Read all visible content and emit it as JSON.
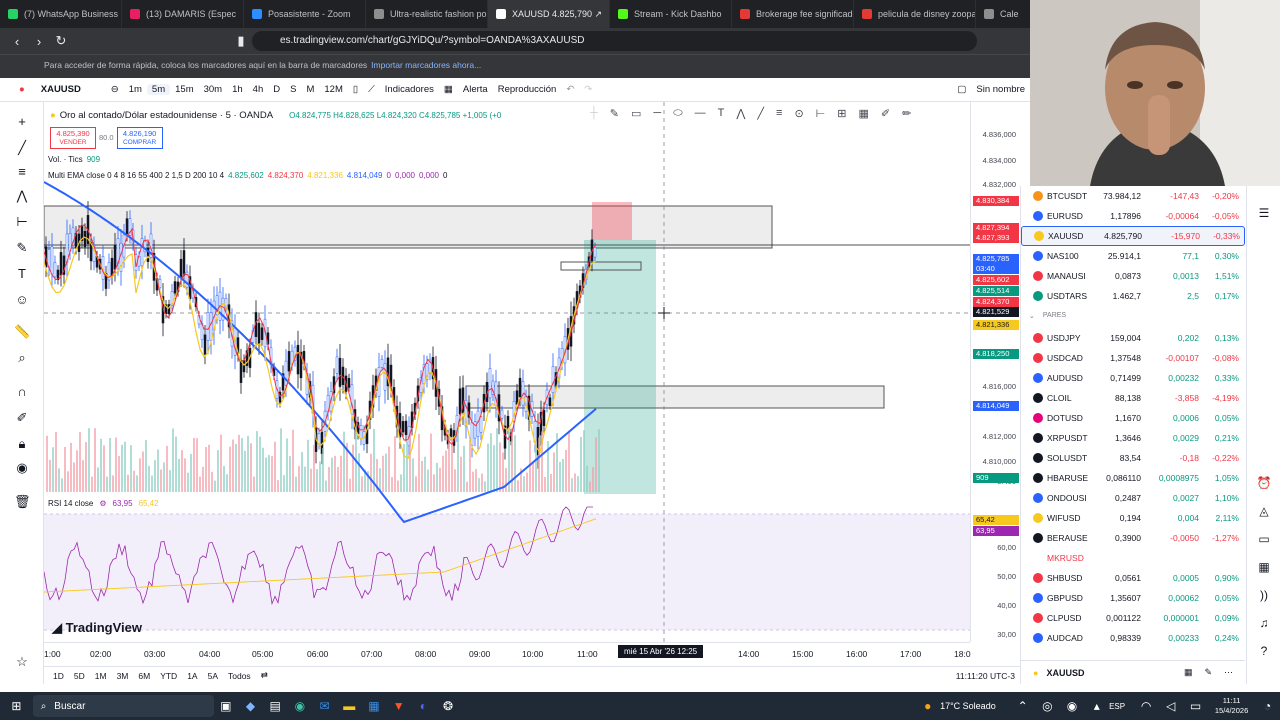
{
  "browser": {
    "tabs": [
      {
        "label": "(7) WhatsApp Business",
        "color": "#25d366"
      },
      {
        "label": "(13) DAMARIS (Espec",
        "color": "#e91e63"
      },
      {
        "label": "Posasistente - Zoom",
        "color": "#2d8cff"
      },
      {
        "label": "Ultra-realistic fashion po",
        "color": "#8e8e8e"
      },
      {
        "label": "XAUUSD 4.825,790 ↗",
        "color": "#ffffff"
      },
      {
        "label": "Stream - Kick Dashbo",
        "color": "#53fc18"
      },
      {
        "label": "Brokerage fee significado",
        "color": "#e53935"
      },
      {
        "label": "pelicula de disney zoopa",
        "color": "#e53935"
      },
      {
        "label": "Cale",
        "color": "#8e8e8e"
      }
    ],
    "url": "es.tradingview.com/chart/gGJYiDQu/?symbol=OANDA%3AXAUUSD",
    "bookmarks_text": "Para acceder de forma rápida, coloca los marcadores aquí en la barra de marcadores",
    "bookmarks_link": "Importar marcadores ahora..."
  },
  "toolbar": {
    "symbol": "XAUUSD",
    "intervals": [
      "1m",
      "5m",
      "15m",
      "30m",
      "1h",
      "4h",
      "D",
      "S",
      "M",
      "12M"
    ],
    "indicators": "Indicadores",
    "alert": "Alerta",
    "replay": "Reproducción",
    "sin_nombre": "Sin nombre",
    "guardar": "Guardar"
  },
  "legend": {
    "title": "Oro al contado/Dólar estadounidense · 5 · OANDA",
    "ohlc": "O4.824,775 H4.828,625 L4.824,320 C4.825,785 +1,005 (+0",
    "sell_price": "4.825,390",
    "sell_label": "VENDER",
    "spread": "80.0",
    "buy_price": "4.826,190",
    "buy_label": "COMPRAR",
    "vol": "Vol. · Tics",
    "vol_value": "909",
    "ema": "Multi EMA close 0 4 8 16 55 400 2 1,5 D 200 10 4",
    "ema_values": [
      "4.825,602",
      "4.824,370",
      "4.821,336",
      "4.814,049",
      "0",
      "0,000",
      "0,000",
      "0"
    ],
    "rsi": "RSI 14 close",
    "rsi_values": [
      "63,95",
      "65,42"
    ]
  },
  "price_axis": {
    "ticks": [
      "4.836,000",
      "4.834,000",
      "4.832,000",
      "4.816,000",
      "4.812,000",
      "4.810,000",
      "8.400",
      "70,00",
      "60,00",
      "50,00",
      "40,00",
      "30,00"
    ],
    "labels": [
      {
        "text": "4.830,384",
        "color": "#f23645"
      },
      {
        "text": "4.827,394",
        "color": "#f23645"
      },
      {
        "text": "4.827,393",
        "color": "#f23645"
      },
      {
        "text": "4.825,785",
        "color": "#2962ff"
      },
      {
        "text": "03:40",
        "color": "#2962ff"
      },
      {
        "text": "4.825,602",
        "color": "#f23645"
      },
      {
        "text": "4.825,514",
        "color": "#089981"
      },
      {
        "text": "4.824,370",
        "color": "#f23645"
      },
      {
        "text": "4.821,529",
        "color": "#131722"
      },
      {
        "text": "4.821,336",
        "color": "#f7c81e"
      },
      {
        "text": "4.818,250",
        "color": "#089981"
      },
      {
        "text": "4.814,049",
        "color": "#2962ff"
      },
      {
        "text": "909",
        "color": "#089981"
      },
      {
        "text": "65,42",
        "color": "#f7c81e"
      },
      {
        "text": "63,95",
        "color": "#9c27b0"
      }
    ]
  },
  "time_axis": {
    "ticks": [
      "1:00",
      "02:00",
      "03:00",
      "04:00",
      "05:00",
      "06:00",
      "07:00",
      "08:00",
      "09:00",
      "10:00",
      "11:00",
      "14:00",
      "15:00",
      "16:00",
      "17:00",
      "18:0"
    ],
    "crosshair": "mié 15 Abr '26   12:25"
  },
  "bottom": {
    "ranges": [
      "1D",
      "5D",
      "1M",
      "3M",
      "6M",
      "YTD",
      "1A",
      "5A",
      "Todos"
    ],
    "clock": "11:11:20 UTC-3"
  },
  "watermark": "TradingView",
  "watchlist": {
    "section": "PARES",
    "footer_symbol": "XAUUSD",
    "rows": [
      {
        "sym": "BTCUSDT",
        "last": "73.984,12",
        "chg": "-147,43",
        "pct": "-0,20%",
        "dir": "neg",
        "icon": "#f7931a"
      },
      {
        "sym": "EURUSD",
        "last": "1,17896",
        "chg": "-0,00064",
        "pct": "-0,05%",
        "dir": "neg",
        "icon": "#2962ff"
      },
      {
        "sym": "XAUUSD",
        "last": "4.825,790",
        "chg": "-15,970",
        "pct": "-0,33%",
        "dir": "neg",
        "icon": "#f7c81e"
      },
      {
        "sym": "NAS100",
        "last": "25.914,1",
        "chg": "77,1",
        "pct": "0,30%",
        "dir": "pos",
        "icon": "#2962ff"
      },
      {
        "sym": "MANAUSI",
        "last": "0,0873",
        "chg": "0,0013",
        "pct": "1,51%",
        "dir": "pos",
        "icon": "#f23645"
      },
      {
        "sym": "USDTARS",
        "last": "1.462,7",
        "chg": "2,5",
        "pct": "0,17%",
        "dir": "pos",
        "icon": "#089981"
      },
      {
        "sym": "USDJPY",
        "last": "159,004",
        "chg": "0,202",
        "pct": "0,13%",
        "dir": "pos",
        "icon": "#f23645"
      },
      {
        "sym": "USDCAD",
        "last": "1,37548",
        "chg": "-0,00107",
        "pct": "-0,08%",
        "dir": "neg",
        "icon": "#f23645"
      },
      {
        "sym": "AUDUSD",
        "last": "0,71499",
        "chg": "0,00232",
        "pct": "0,33%",
        "dir": "pos",
        "icon": "#2962ff"
      },
      {
        "sym": "CLOIL",
        "last": "88,138",
        "chg": "-3,858",
        "pct": "-4,19%",
        "dir": "neg",
        "icon": "#131722"
      },
      {
        "sym": "DOTUSD",
        "last": "1,1670",
        "chg": "0,0006",
        "pct": "0,05%",
        "dir": "pos",
        "icon": "#e6007a"
      },
      {
        "sym": "XRPUSDT",
        "last": "1,3646",
        "chg": "0,0029",
        "pct": "0,21%",
        "dir": "pos",
        "icon": "#131722"
      },
      {
        "sym": "SOLUSDT",
        "last": "83,54",
        "chg": "-0,18",
        "pct": "-0,22%",
        "dir": "neg",
        "icon": "#131722"
      },
      {
        "sym": "HBARUSE",
        "last": "0,086110",
        "chg": "0,0008975",
        "pct": "1,05%",
        "dir": "pos",
        "icon": "#131722"
      },
      {
        "sym": "ONDOUSI",
        "last": "0,2487",
        "chg": "0,0027",
        "pct": "1,10%",
        "dir": "pos",
        "icon": "#2962ff"
      },
      {
        "sym": "WIFUSD",
        "last": "0,194",
        "chg": "0,004",
        "pct": "2,11%",
        "dir": "pos",
        "icon": "#f7c81e"
      },
      {
        "sym": "BERAUSE",
        "last": "0,3900",
        "chg": "-0,0050",
        "pct": "-1,27%",
        "dir": "neg",
        "icon": "#131722"
      },
      {
        "sym": "MKRUSD",
        "last": "",
        "chg": "",
        "pct": "",
        "dir": "neg",
        "icon": "#ffffff"
      },
      {
        "sym": "SHBUSD",
        "last": "0,0561",
        "chg": "0,0005",
        "pct": "0,90%",
        "dir": "pos",
        "icon": "#f23645"
      },
      {
        "sym": "GBPUSD",
        "last": "1,35607",
        "chg": "0,00062",
        "pct": "0,05%",
        "dir": "pos",
        "icon": "#2962ff"
      },
      {
        "sym": "CLPUSD",
        "last": "0,001122",
        "chg": "0,000001",
        "pct": "0,09%",
        "dir": "pos",
        "icon": "#f23645"
      },
      {
        "sym": "AUDCAD",
        "last": "0,98339",
        "chg": "0,00233",
        "pct": "0,24%",
        "dir": "pos",
        "icon": "#2962ff"
      }
    ]
  },
  "taskbar": {
    "search": "Buscar",
    "weather": "17°C  Soleado",
    "lang": "ESP",
    "time": "11:11",
    "date": "15/4/2026"
  }
}
